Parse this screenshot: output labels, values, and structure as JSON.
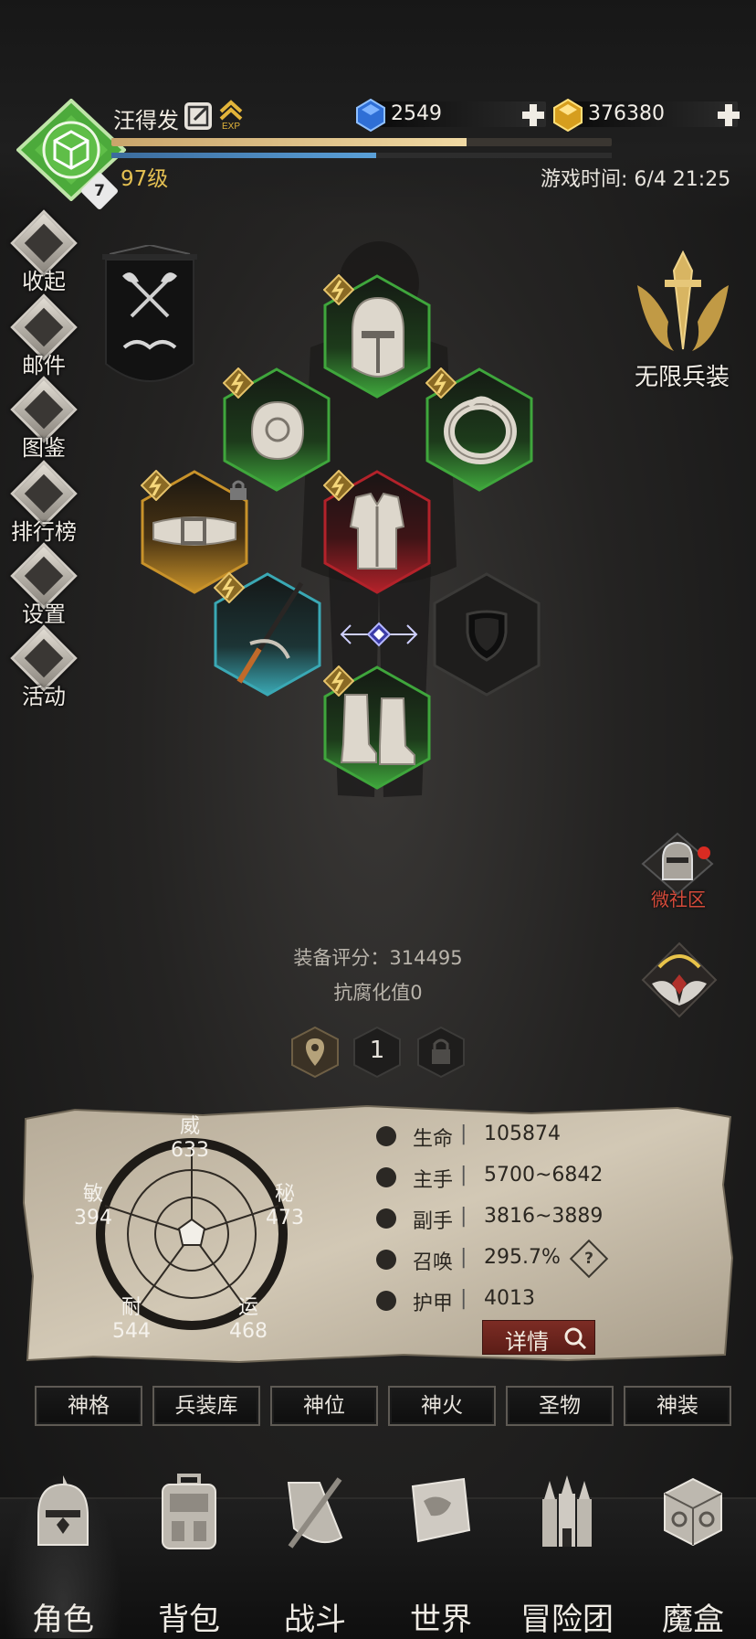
{
  "player": {
    "name": "汪得发",
    "level_text": "97级",
    "rank_badge": "7",
    "exp_progress": 0.71,
    "secondary_progress": 0.53
  },
  "currencies": [
    {
      "name": "diamond",
      "value": "2549",
      "icon": "blue-gem-icon"
    },
    {
      "name": "gold",
      "value": "376380",
      "icon": "gold-gem-icon"
    }
  ],
  "game_time": "游戏时间: 6/4 21:25",
  "side_menu": [
    {
      "key": "collapse",
      "label": "收起",
      "icon": "collapse-icon"
    },
    {
      "key": "mail",
      "label": "邮件",
      "icon": "mail-icon"
    },
    {
      "key": "codex",
      "label": "图鉴",
      "icon": "book-icon"
    },
    {
      "key": "ranking",
      "label": "排行榜",
      "icon": "ranking-icon"
    },
    {
      "key": "settings",
      "label": "设置",
      "icon": "gear-icon"
    },
    {
      "key": "events",
      "label": "活动",
      "icon": "event-icon"
    }
  ],
  "equipment": [
    {
      "slot": "helmet",
      "rarity": "green",
      "icon": "helmet-icon"
    },
    {
      "slot": "gloves",
      "rarity": "green",
      "icon": "gauntlet-icon"
    },
    {
      "slot": "ring",
      "rarity": "green",
      "icon": "ring-icon"
    },
    {
      "slot": "belt",
      "rarity": "gold",
      "icon": "belt-icon",
      "locked": true
    },
    {
      "slot": "chest",
      "rarity": "red",
      "icon": "armor-icon"
    },
    {
      "slot": "weapon",
      "rarity": "cyan",
      "icon": "sword-icon"
    },
    {
      "slot": "offhand",
      "rarity": "empty",
      "icon": "shield-icon"
    },
    {
      "slot": "boots",
      "rarity": "green",
      "icon": "boots-icon"
    }
  ],
  "colors": {
    "green": "#3fa63c",
    "gold": "#c8922a",
    "red": "#b3222a",
    "cyan": "#3aa8b4",
    "exp": "#e9cf94",
    "level": "#e4c052",
    "community": "#d44a3a"
  },
  "infinite_arms": {
    "label": "无限兵装"
  },
  "community": {
    "label": "微社区"
  },
  "equipment_score": "装备评分：314495",
  "corruption_resist": "抗腐化值0",
  "small_slots": [
    {
      "icon": "location-pin-icon"
    },
    {
      "icon": "number",
      "text": "1"
    },
    {
      "icon": "lock-icon"
    }
  ],
  "radar": {
    "stats": [
      {
        "name": "威",
        "value": "633"
      },
      {
        "name": "秘",
        "value": "473"
      },
      {
        "name": "运",
        "value": "468"
      },
      {
        "name": "耐",
        "value": "544"
      },
      {
        "name": "敏",
        "value": "394"
      }
    ]
  },
  "attributes": [
    {
      "name": "生命",
      "value": "105874",
      "icon": "heart-icon"
    },
    {
      "name": "主手",
      "value": "5700~6842",
      "icon": "sword-icon"
    },
    {
      "name": "副手",
      "value": "3816~3889",
      "icon": "dagger-icon"
    },
    {
      "name": "召唤",
      "value": "295.7%",
      "icon": "summon-icon"
    },
    {
      "name": "护甲",
      "value": "4013",
      "icon": "armor-icon"
    }
  ],
  "help": "?",
  "detail_button": "详情",
  "tabs": [
    "神格",
    "兵装库",
    "神位",
    "神火",
    "圣物",
    "神装"
  ],
  "bottom_nav": [
    {
      "label": "角色",
      "icon": "helmet-icon",
      "active": true
    },
    {
      "label": "背包",
      "icon": "backpack-icon"
    },
    {
      "label": "战斗",
      "icon": "crossed-swords-icon"
    },
    {
      "label": "世界",
      "icon": "map-icon"
    },
    {
      "label": "冒险团",
      "icon": "castle-icon"
    },
    {
      "label": "魔盒",
      "icon": "cube-icon"
    }
  ]
}
